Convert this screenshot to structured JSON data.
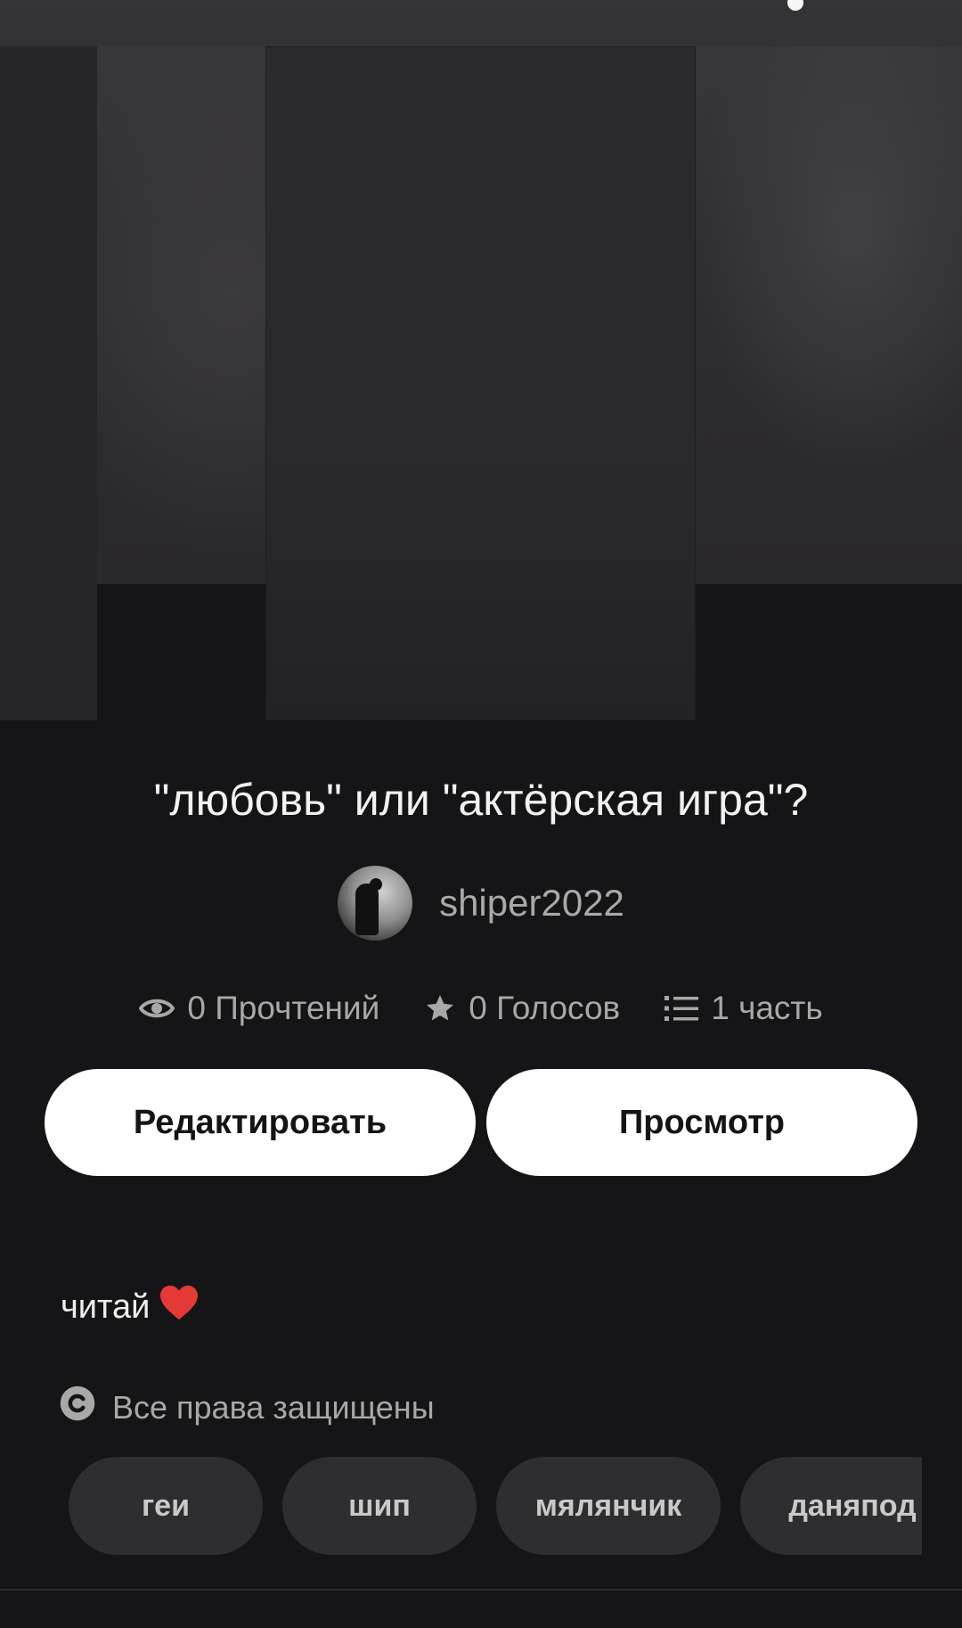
{
  "story": {
    "title": "\"любовь\" или \"актёрская игра\"?",
    "author": {
      "username": "shiper2022"
    },
    "stats": {
      "reads": "0 Прочтений",
      "votes": "0 Голосов",
      "parts": "1 часть"
    },
    "description": "читай",
    "copyright": "Все права защищены",
    "tags": [
      "геи",
      "шип",
      "мялянчик",
      "даняпод"
    ]
  },
  "actions": {
    "edit_label": "Редактировать",
    "view_label": "Просмотр"
  },
  "icons": {
    "reads": "eye-icon",
    "votes": "star-icon",
    "parts": "list-icon",
    "description_emoji": "red-heart-icon",
    "copyright": "copyright-icon"
  },
  "colors": {
    "background": "#151416",
    "button_bg": "#ffffff",
    "button_text": "#141414",
    "tag_bg": "#2e2d30",
    "secondary_text": "#a8a8a8",
    "heart": "#e53935"
  }
}
